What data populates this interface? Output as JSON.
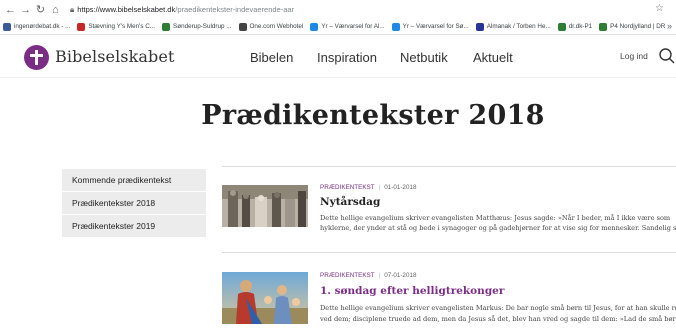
{
  "browser": {
    "url_host": "https://www.bibelselskabet.dk",
    "url_path": "/praedikentekster-indevaerende-aar",
    "bookmarks": [
      {
        "label": "ingenørdebat.dk - ...",
        "color": "#3b5998"
      },
      {
        "label": "Stævning Y's Men's C...",
        "color": "#c62828"
      },
      {
        "label": "Sønderup-Suldrup ...",
        "color": "#2e7d32"
      },
      {
        "label": "One.com Webhotel",
        "color": "#444444"
      },
      {
        "label": "Yr – Værvarsel for Al...",
        "color": "#1e88e5"
      },
      {
        "label": "Yr – Værvarsel for Sø...",
        "color": "#1e88e5"
      },
      {
        "label": "Almanak / Torben He...",
        "color": "#283593"
      },
      {
        "label": "dr.dk-P1",
        "color": "#2e7d32"
      },
      {
        "label": "P4 Nordjylland | DR",
        "color": "#2e7d32"
      }
    ]
  },
  "header": {
    "brand": "Bibelselskabet",
    "nav": [
      "Bibelen",
      "Inspiration",
      "Netbutik",
      "Aktuelt"
    ],
    "login": "Log ind",
    "accent": "#7b2d85"
  },
  "page": {
    "title": "Prædikentekster 2018"
  },
  "sidebar": {
    "items": [
      {
        "label": "Kommende prædikentekst"
      },
      {
        "label": "Prædikentekster 2018"
      },
      {
        "label": "Prædikentekster 2019"
      }
    ]
  },
  "articles": [
    {
      "category": "PRÆDIKENTEKST",
      "date": "01-01-2018",
      "title": "Nytårsdag",
      "line1": "Dette hellige evangelium skriver evangelisten Matthæus: Jesus sagde: »Når I beder, må I ikke være som",
      "line2": "hyklerne, der ynder at stå og bede i synagoger og på gadehjørner for at vise sig for mennesker. Sandelig sige"
    },
    {
      "category": "PRÆDIKENTEKST",
      "date": "07-01-2018",
      "title": "1. søndag efter helligtrekonger",
      "line1": "Dette hellige evangelium skriver evangelisten Markus: De bar nogle små børn til Jesus, for at han skulle røre",
      "line2": "ved dem; disciplene truede ad dem, men da Jesus så det, blev han vred og sagde til dem: »Lad de små børn..."
    }
  ]
}
